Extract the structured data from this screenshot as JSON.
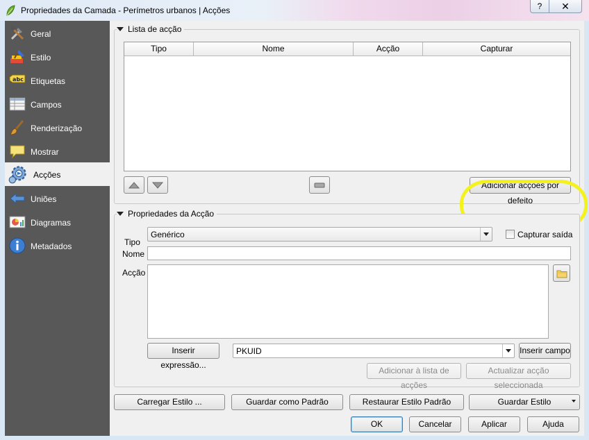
{
  "window": {
    "title": "Propriedades da Camada - Perímetros urbanos | Acções",
    "help_label": "?",
    "close_label": "✕",
    "icon": "qgis-leaf-icon"
  },
  "sidebar": {
    "items": [
      {
        "label": "Geral",
        "icon": "wrench-hammer-icon",
        "active": false
      },
      {
        "label": "Estilo",
        "icon": "paint-brush-icon",
        "active": false
      },
      {
        "label": "Etiquetas",
        "icon": "abc-label-icon",
        "active": false
      },
      {
        "label": "Campos",
        "icon": "table-fields-icon",
        "active": false
      },
      {
        "label": "Renderização",
        "icon": "brush-render-icon",
        "active": false
      },
      {
        "label": "Mostrar",
        "icon": "speech-bubble-icon",
        "active": false
      },
      {
        "label": "Acções",
        "icon": "gear-action-icon",
        "active": true
      },
      {
        "label": "Uniões",
        "icon": "join-icon",
        "active": false
      },
      {
        "label": "Diagramas",
        "icon": "diagram-icon",
        "active": false
      },
      {
        "label": "Metadados",
        "icon": "info-icon",
        "active": false
      }
    ]
  },
  "action_list": {
    "title": "Lista de acção",
    "columns": [
      "Tipo",
      "Nome",
      "Acção",
      "Capturar"
    ],
    "rows": [],
    "move_up_icon": "arrow-up-icon",
    "move_down_icon": "arrow-down-icon",
    "remove_icon": "remove-icon",
    "add_default_label": "Adicionar acções por defeito"
  },
  "action_props": {
    "title": "Propriedades da Acção",
    "tipo_label": "Tipo",
    "tipo_value": "Genérico",
    "capture_label": "Capturar saída",
    "capture_checked": false,
    "nome_label": "Nome",
    "nome_value": "",
    "accao_label": "Acção",
    "accao_value": "",
    "browse_icon": "folder-icon",
    "insert_expression_label": "Inserir expressão...",
    "field_value": "PKUID",
    "insert_field_label": "Inserir campo",
    "add_to_list_label": "Adicionar à lista de acções",
    "update_selected_label": "Actualizar acção seleccionada"
  },
  "style_buttons": {
    "load": "Carregar Estilo ...",
    "save_default": "Guardar como Padrão",
    "restore_default": "Restaurar Estilo Padrão",
    "save": "Guardar Estilo"
  },
  "dialog_buttons": {
    "ok": "OK",
    "cancel": "Cancelar",
    "apply": "Aplicar",
    "help": "Ajuda"
  },
  "colors": {
    "sidebar_bg": "#585858",
    "highlight": "#f4f21c",
    "default_button_border": "#3c7fb1"
  }
}
